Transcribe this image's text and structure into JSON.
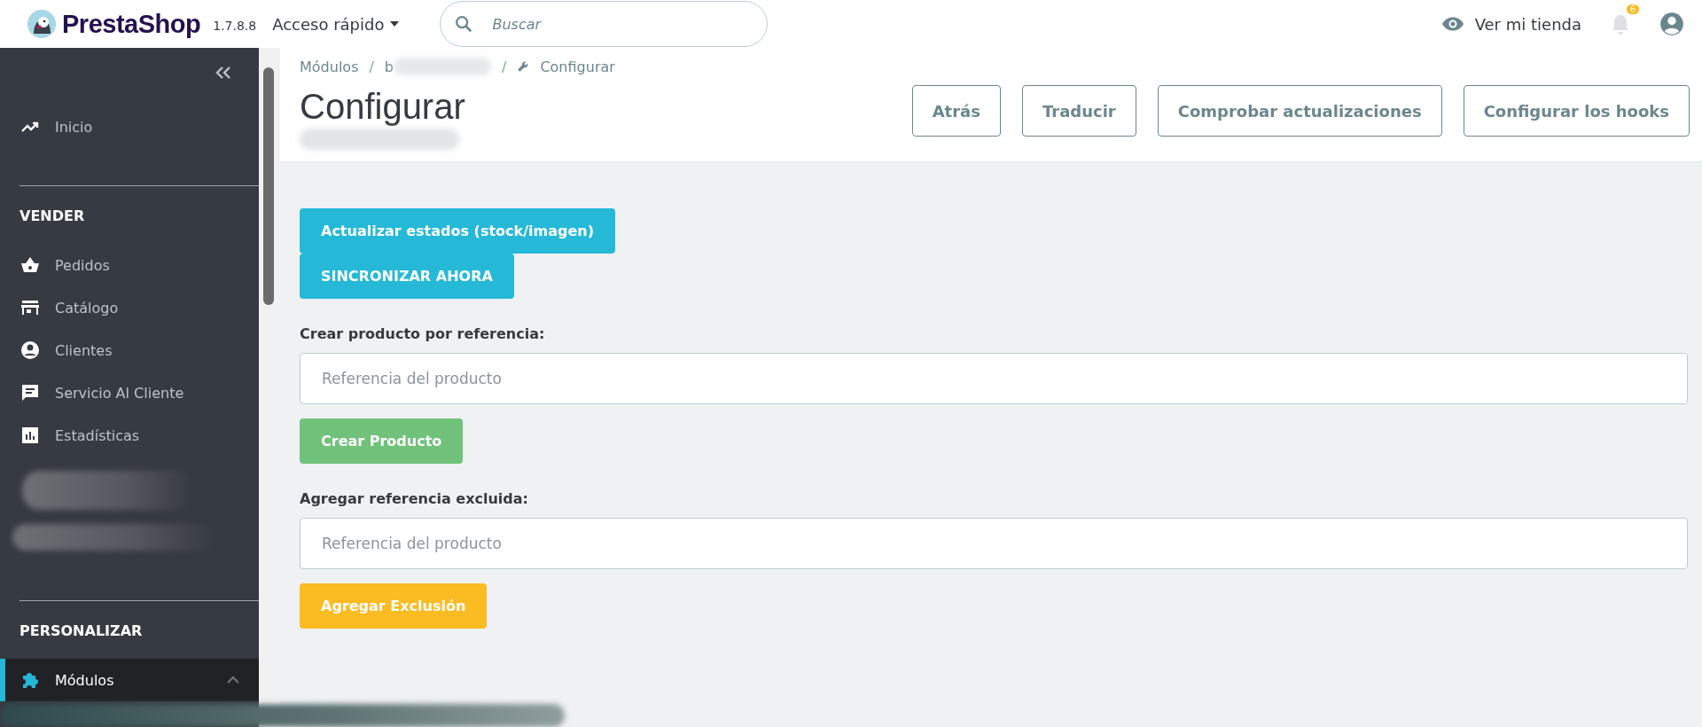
{
  "header": {
    "brand": "PrestaShop",
    "version": "1.7.8.8",
    "quick_access": "Acceso rápido",
    "search": {
      "placeholder": "Buscar"
    },
    "view_store": "Ver mi tienda",
    "notifications": "6"
  },
  "sidebar": {
    "top": [
      {
        "label": "Inicio",
        "selected": false
      }
    ],
    "sections": [
      {
        "title": "VENDER",
        "items": [
          {
            "label": "Pedidos",
            "selected": false
          },
          {
            "label": "Catálogo",
            "selected": false
          },
          {
            "label": "Clientes",
            "selected": false
          },
          {
            "label": "Servicio Al Cliente",
            "selected": false
          },
          {
            "label": "Estadísticas",
            "selected": false
          }
        ]
      },
      {
        "title": "PERSONALIZAR",
        "items": [
          {
            "label": "Módulos",
            "selected": true,
            "expanded": true
          }
        ]
      }
    ]
  },
  "breadcrumb": [
    {
      "kind": "link",
      "text": "Módulos"
    },
    {
      "kind": "separator",
      "text": "/"
    },
    {
      "kind": "link",
      "text": "b"
    },
    {
      "kind": "separator",
      "text": "/"
    },
    {
      "kind": "current",
      "text": "Configurar"
    }
  ],
  "page_title": "Configurar",
  "toolbar": [
    "Atrás",
    "Traducir",
    "Comprobar actualizaciones",
    "Configurar los hooks"
  ],
  "content": [
    {
      "kind": "button",
      "label": "Actualizar estados (stock/imagen)",
      "color": "#25b9d7"
    },
    {
      "kind": "button",
      "label": "SINCRONIZAR AHORA",
      "color": "#25b9d7"
    },
    {
      "kind": "field",
      "label": "Crear producto por referencia:",
      "placeholder": "Referencia del producto"
    },
    {
      "kind": "button",
      "label": "Crear Producto",
      "color": "#70c27a"
    },
    {
      "kind": "field",
      "label": "Agregar referencia excluida:",
      "placeholder": "Referencia del producto"
    },
    {
      "kind": "button",
      "label": "Agregar Exclusión",
      "color": "#fbbb22"
    }
  ]
}
